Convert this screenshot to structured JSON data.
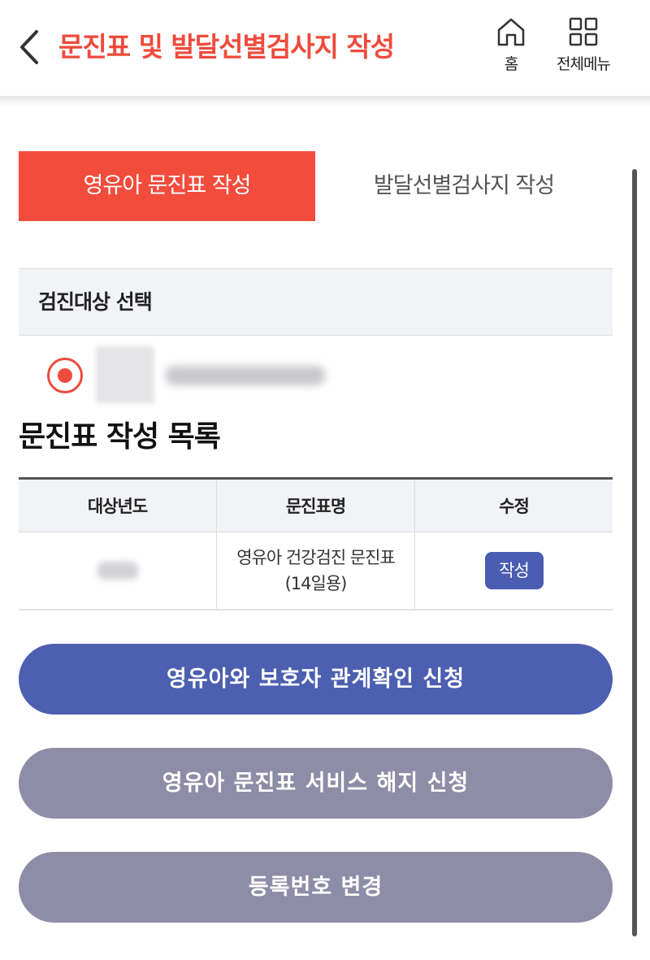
{
  "header": {
    "title": "문진표 및 발달선별검사지 작성",
    "home_label": "홈",
    "menu_label": "전체메뉴"
  },
  "tabs": [
    {
      "label": "영유아 문진표 작성",
      "active": true
    },
    {
      "label": "발달선별검사지 작성",
      "active": false
    }
  ],
  "target": {
    "section_title": "검진대상 선택",
    "selected": true
  },
  "list": {
    "title": "문진표 작성 목록",
    "columns": [
      "대상년도",
      "문진표명",
      "수정"
    ],
    "rows": [
      {
        "doc_name": "영유아 건강검진 문진표(14일용)",
        "action_label": "작성"
      }
    ]
  },
  "buttons": {
    "relation": "영유아와 보호자 관계확인 신청",
    "cancel_service": "영유아 문진표 서비스 해지 신청",
    "change_reg": "등록번호 변경"
  },
  "colors": {
    "accent_red": "#f24c3d",
    "primary_blue": "#4c5fb0",
    "muted_purple": "#8e8ca6"
  }
}
